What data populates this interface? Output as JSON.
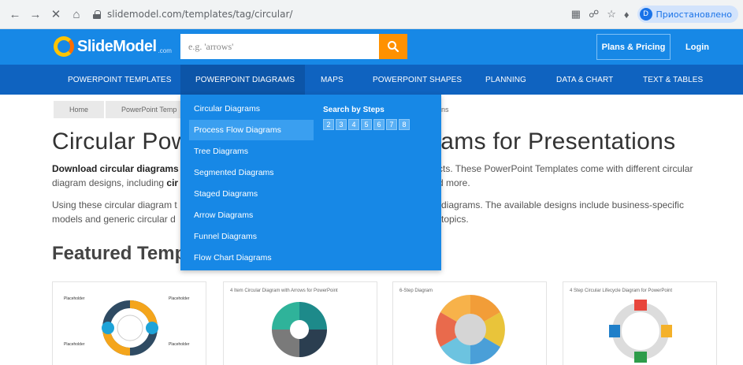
{
  "browser": {
    "back_icon": "arrow-left-icon",
    "forward_icon": "arrow-right-icon",
    "close_icon": "close-icon",
    "home_icon": "home-icon",
    "url": "slidemodel.com/templates/tag/circular/",
    "profile_initial": "D",
    "profile_label": "Приостановлено"
  },
  "header": {
    "logo_text": "SlideModel",
    "logo_tld": ".com",
    "search_placeholder": "e.g. 'arrows'",
    "plans_label": "Plans & Pricing",
    "login_label": "Login"
  },
  "nav": {
    "items": [
      {
        "label": "POWERPOINT TEMPLATES"
      },
      {
        "label": "POWERPOINT DIAGRAMS"
      },
      {
        "label": "MAPS"
      },
      {
        "label": "POWERPOINT SHAPES"
      },
      {
        "label": "PLANNING"
      },
      {
        "label": "DATA & CHART"
      },
      {
        "label": "TEXT & TABLES"
      }
    ]
  },
  "breadcrumb": [
    "Home",
    "PowerPoint Temp",
    "ns"
  ],
  "page": {
    "title_left": "Circular Pow",
    "title_right": "rams for Presentations",
    "p1_bold": "Download circular diagrams",
    "p1_right": "cts. These PowerPoint Templates come with different circular",
    "p1_line2_left": "diagram designs, including ",
    "p1_line2_bold": "cir",
    "p1_line2_right": "d more.",
    "p2_line1_left": "Using these circular diagram t",
    "p2_line1_right": "d diagrams. The available designs include business-specific",
    "p2_line2_left": "models and generic circular d",
    "p2_line2_right": "topics.",
    "featured_title": "Featured Templ"
  },
  "dropdown": {
    "items": [
      {
        "label": "Circular Diagrams"
      },
      {
        "label": "Process Flow Diagrams"
      },
      {
        "label": "Tree Diagrams"
      },
      {
        "label": "Segmented Diagrams"
      },
      {
        "label": "Staged Diagrams"
      },
      {
        "label": "Arrow Diagrams"
      },
      {
        "label": "Funnel Diagrams"
      },
      {
        "label": "Flow Chart Diagrams"
      }
    ],
    "steps_title": "Search by Steps",
    "steps": [
      "2",
      "3",
      "4",
      "5",
      "6",
      "7",
      "8"
    ]
  },
  "cards": [
    {
      "caption": "",
      "placeholder_label": "Placeholder"
    },
    {
      "caption": "4 Item Circular Diagram with Arrows for PowerPoint"
    },
    {
      "caption": "6-Step Diagram"
    },
    {
      "caption": "4 Step Circular Lifecycle Diagram for PowerPoint"
    }
  ]
}
